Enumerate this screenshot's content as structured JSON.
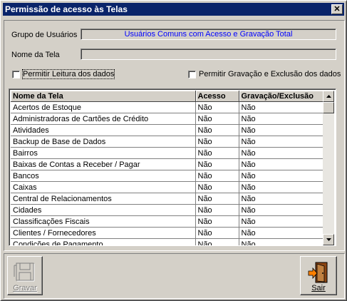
{
  "window": {
    "title": "Permissão de acesso às Telas"
  },
  "form": {
    "grupo_label": "Grupo de Usuários",
    "grupo_value": "Usuários Comuns com Acesso e Gravação Total",
    "nome_label": "Nome da Tela",
    "nome_value": "",
    "chk_leitura": {
      "label": "Permitir Leitura dos dados",
      "checked": false
    },
    "chk_gravacao": {
      "label": "Permitir Gravação e Exclusão dos dados",
      "checked": false
    }
  },
  "grid": {
    "headers": [
      "Nome da Tela",
      "Acesso",
      "Gravação/Exclusão"
    ],
    "rows": [
      [
        "Acertos de Estoque",
        "Não",
        "Não"
      ],
      [
        "Administradoras de Cartões de Crédito",
        "Não",
        "Não"
      ],
      [
        "Atividades",
        "Não",
        "Não"
      ],
      [
        "Backup de Base de Dados",
        "Não",
        "Não"
      ],
      [
        "Bairros",
        "Não",
        "Não"
      ],
      [
        "Baixas de Contas a Receber / Pagar",
        "Não",
        "Não"
      ],
      [
        "Bancos",
        "Não",
        "Não"
      ],
      [
        "Caixas",
        "Não",
        "Não"
      ],
      [
        "Central de Relacionamentos",
        "Não",
        "Não"
      ],
      [
        "Cidades",
        "Não",
        "Não"
      ],
      [
        "Classificações Fiscais",
        "Não",
        "Não"
      ],
      [
        "Clientes / Fornecedores",
        "Não",
        "Não"
      ],
      [
        "Condições de Pagamento",
        "Não",
        "Não"
      ]
    ]
  },
  "buttons": {
    "gravar": {
      "label": "Gravar",
      "enabled": false,
      "icon": "floppy-disk-icon"
    },
    "sair": {
      "label": "Sair",
      "enabled": true,
      "icon": "exit-door-icon"
    }
  },
  "icons": {
    "close": "close-icon",
    "scroll_up": "arrow-up-icon",
    "scroll_down": "arrow-down-icon"
  }
}
